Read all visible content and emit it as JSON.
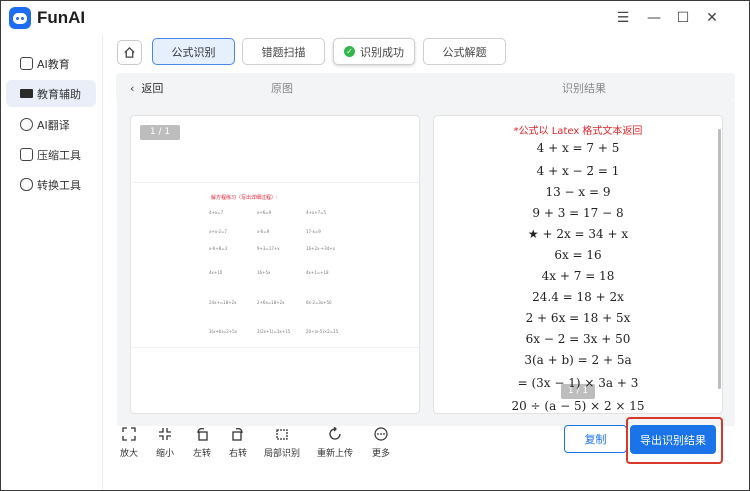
{
  "app": {
    "title": "FunAI"
  },
  "window_controls": {
    "menu": "☰",
    "minimize": "—",
    "maximize": "☐",
    "close": "✕"
  },
  "sidebar": {
    "items": [
      {
        "label": "AI教育",
        "icon": "graduation-cap-icon"
      },
      {
        "label": "教育辅助",
        "icon": "book-icon",
        "active": true
      },
      {
        "label": "AI翻译",
        "icon": "translate-icon"
      },
      {
        "label": "压缩工具",
        "icon": "compress-icon"
      },
      {
        "label": "转换工具",
        "icon": "convert-icon"
      }
    ]
  },
  "tabs": [
    {
      "label": "公式识别",
      "active": true
    },
    {
      "label": "错题扫描",
      "active": false
    },
    {
      "label": "识别成功",
      "toast": true
    },
    {
      "label": "公式解题",
      "active": false
    }
  ],
  "subbar": {
    "back": "返回",
    "original": "原图",
    "result": "识别结果"
  },
  "left_panel": {
    "page_badge": "1 / 1",
    "doc_title": "解方程练习（写出详细过程）:",
    "doc_rows": [
      [
        "4+x=7",
        "x+6=9",
        "4+x+7=5"
      ],
      [
        "x+x-2=7",
        "x-6=9",
        "17-x=9"
      ],
      [
        "x-6+8=3",
        "9+3=17+x",
        "16+2x-+34+x"
      ],
      [
        "4x+10",
        "16+5x",
        "4x+1=+18"
      ],
      [
        "24x+=18+2x",
        "2+6x=18+2x",
        "6x-2=3x+50"
      ],
      [
        "3(x+b)=2+5x",
        "3(2x+1)=3x+15",
        "20÷(x-5)×2=15"
      ]
    ]
  },
  "right_panel": {
    "note": "*公式以 Latex 格式文本返回",
    "formulas": [
      "4 + x = 7 + 5",
      "4 + x − 2̄ = 1",
      "13 − x = 9",
      "9 + 3 = 17 − 8",
      "★ + 2x = 34 + x",
      "6x = 16",
      "4x + 7 = 18",
      "24.4 = 18 + 2x",
      "2 + 6x = 18 + 5x",
      "6x − 2 = 3x + 50",
      "3(a + b) = 2 + 5a",
      "= (3x − 1) × 3a + 3",
      "20 ÷ (a − 5) × 2 × 15"
    ],
    "page_badge": "1 / 1"
  },
  "toolbar": [
    {
      "label": "放大",
      "icon": "expand-icon"
    },
    {
      "label": "缩小",
      "icon": "shrink-icon"
    },
    {
      "label": "左转",
      "icon": "rotate-left-icon"
    },
    {
      "label": "右转",
      "icon": "rotate-right-icon"
    },
    {
      "label": "局部识别",
      "icon": "crop-icon"
    },
    {
      "label": "重新上传",
      "icon": "reupload-icon"
    },
    {
      "label": "更多",
      "icon": "more-icon"
    }
  ],
  "buttons": {
    "copy": "复制",
    "export": "导出识别结果"
  },
  "colors": {
    "accent": "#1a73e8",
    "success": "#33b64a",
    "alert": "#e0262b",
    "highlight_border": "#d9362c"
  }
}
